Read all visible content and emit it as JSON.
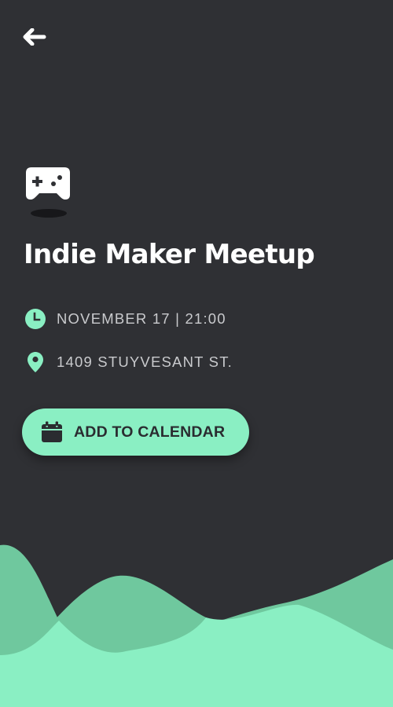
{
  "event": {
    "title": "Indie Maker Meetup",
    "datetime": "NOVEMBER 17 | 21:00",
    "location": "1409 STUYVESANT ST."
  },
  "actions": {
    "add_to_calendar_label": "ADD TO CALENDAR"
  },
  "icons": {
    "back": "arrow-left-icon",
    "event": "gamepad-icon",
    "datetime": "clock-icon",
    "location": "map-pin-icon",
    "calendar": "calendar-icon"
  },
  "colors": {
    "background": "#2f3034",
    "accent": "#8aefc3",
    "accent_dark": "#6fc89e",
    "title_text": "#ffffff",
    "info_text": "#c9cacd",
    "button_text": "#2a2c30"
  }
}
